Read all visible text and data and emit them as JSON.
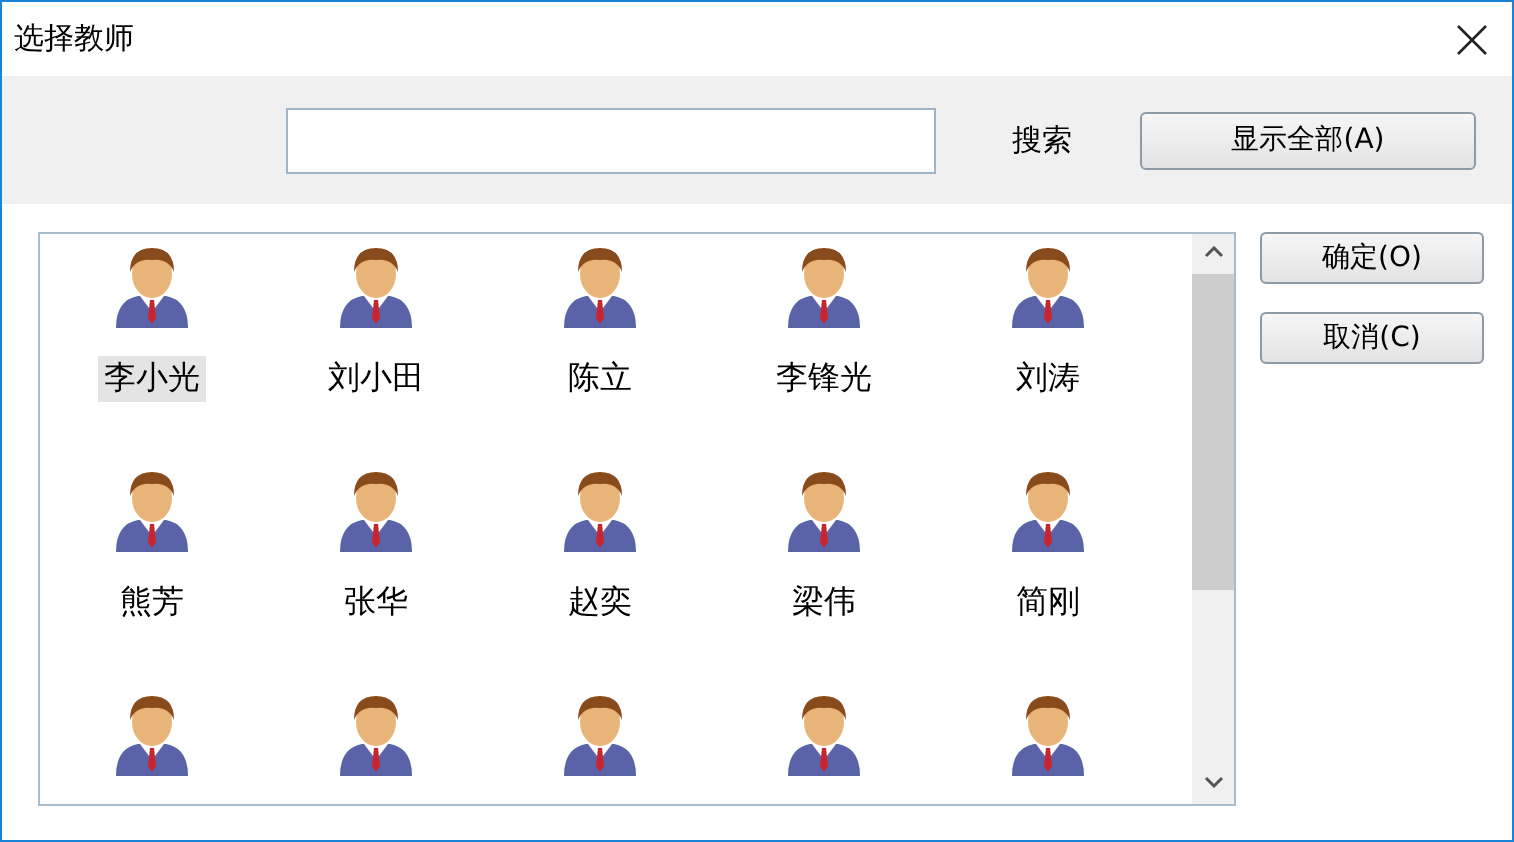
{
  "window": {
    "title": "选择教师"
  },
  "toolbar": {
    "show_all_button": "显示全部(A)",
    "search_label": "搜索"
  },
  "buttons": [
    "确定(O)",
    "取消(C)"
  ],
  "teachers": [
    {
      "name": "李小光",
      "selected": true
    },
    {
      "name": "刘小田",
      "selected": false
    },
    {
      "name": "陈立",
      "selected": false
    },
    {
      "name": "李锋光",
      "selected": false
    },
    {
      "name": "刘涛",
      "selected": false
    },
    {
      "name": "熊芳",
      "selected": false
    },
    {
      "name": "张华",
      "selected": false
    },
    {
      "name": "赵奕",
      "selected": false
    },
    {
      "name": "梁伟",
      "selected": false
    },
    {
      "name": "简刚",
      "selected": false
    },
    {
      "selected": false
    },
    {
      "selected": false
    },
    {
      "selected": false
    },
    {
      "selected": false
    },
    {
      "selected": false
    }
  ]
}
